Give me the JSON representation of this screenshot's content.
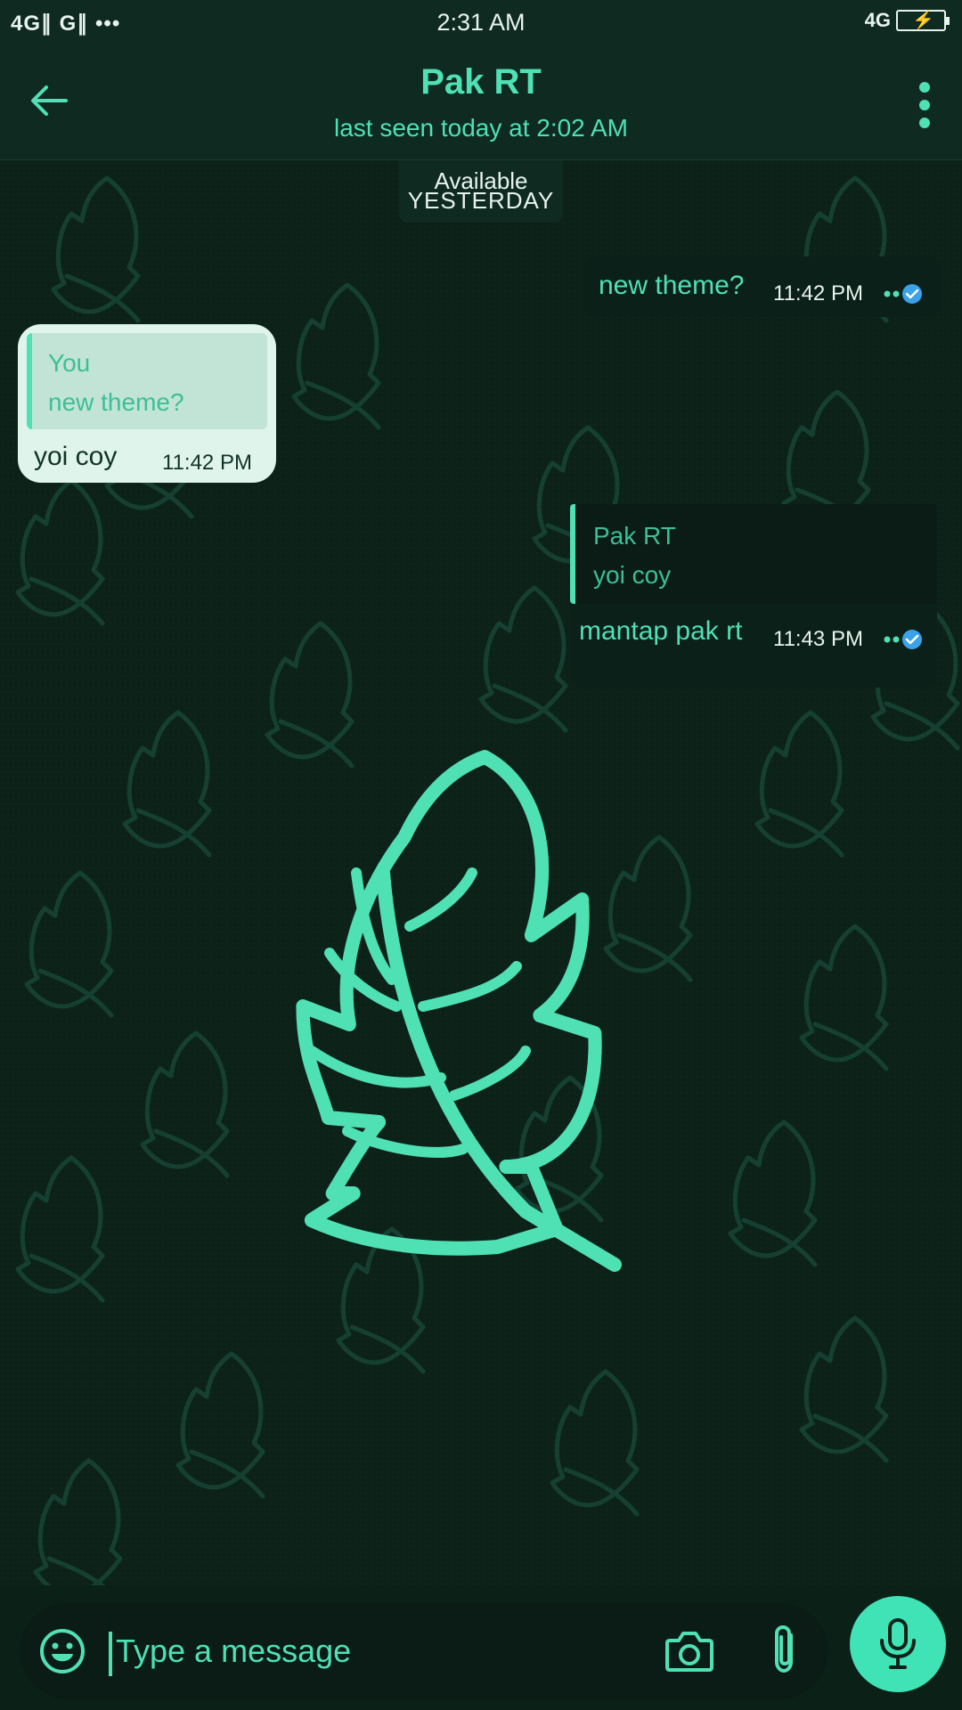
{
  "status_bar": {
    "left": "4G∥ G∥ •••",
    "time": "2:31 AM",
    "network": "4G",
    "battery_state": "charging"
  },
  "header": {
    "title": "Pak RT",
    "subtitle": "last seen today at 2:02 AM",
    "back_icon": "arrow-left-icon",
    "menu_icon": "more-vertical-icon"
  },
  "chat": {
    "status_text": "Available",
    "date_divider": "YESTERDAY",
    "messages": [
      {
        "direction": "out",
        "text": "new theme?",
        "time": "11:42 PM",
        "status": "read"
      },
      {
        "direction": "in",
        "quote_author": "You",
        "quote_text": "new theme?",
        "text": "yoi coy",
        "time": "11:42 PM"
      },
      {
        "direction": "out",
        "quote_author": "Pak RT",
        "quote_text": "yoi coy",
        "text": "mantap pak rt",
        "time": "11:43 PM",
        "status": "read"
      }
    ]
  },
  "composer": {
    "placeholder": "Type a message",
    "emoji_icon": "emoji-icon",
    "camera_icon": "camera-icon",
    "attach_icon": "paperclip-icon",
    "mic_icon": "microphone-icon"
  },
  "colors": {
    "accent": "#4fe0b4",
    "background": "#0c2219",
    "header": "#0e2a21",
    "incoming_bubble": "#dff5ec",
    "mic_button": "#3fe3b5"
  }
}
